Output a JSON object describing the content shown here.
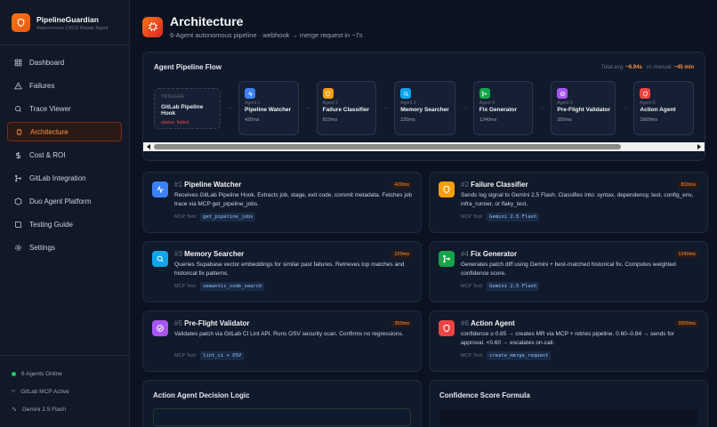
{
  "brand": {
    "title": "PipelineGuardian",
    "subtitle": "Autonomous CI/CD Repair Agent"
  },
  "nav": [
    {
      "label": "Dashboard",
      "icon": "grid-icon"
    },
    {
      "label": "Failures",
      "icon": "warning-icon"
    },
    {
      "label": "Trace Viewer",
      "icon": "search-icon"
    },
    {
      "label": "Architecture",
      "icon": "chip-icon",
      "active": true
    },
    {
      "label": "Cost & ROI",
      "icon": "dollar-icon"
    },
    {
      "label": "GitLab Integration",
      "icon": "branch-icon"
    },
    {
      "label": "Duo Agent Platform",
      "icon": "cube-icon"
    },
    {
      "label": "Testing Guide",
      "icon": "book-icon"
    },
    {
      "label": "Settings",
      "icon": "gear-icon"
    }
  ],
  "footer": [
    {
      "label": "6 Agents Online"
    },
    {
      "label": "GitLab MCP Active"
    },
    {
      "label": "Gemini 2.5 Flash"
    }
  ],
  "page": {
    "title": "Architecture",
    "subtitle": "6-Agent autonomous pipeline · webhook → merge request in ~7s"
  },
  "flow": {
    "title": "Agent Pipeline Flow",
    "total_label": "Total avg:",
    "total_value": "~6.94s",
    "manual_label": "vs manual:",
    "manual_value": "~45 min",
    "trigger": {
      "label": "TRIGGER",
      "name": "GitLab Pipeline Hook",
      "status": "status: failed"
    },
    "agents": [
      {
        "idx": "Agent 1",
        "name": "Pipeline Watcher",
        "ms": "420ms",
        "color": "#3b82f6"
      },
      {
        "idx": "Agent 2",
        "name": "Failure Classifier",
        "ms": "810ms",
        "color": "#f59e0b"
      },
      {
        "idx": "Agent 3",
        "name": "Memory Searcher",
        "ms": "220ms",
        "color": "#0ea5e9"
      },
      {
        "idx": "Agent 4",
        "name": "Fix Generator",
        "ms": "1240ms",
        "color": "#16a34a"
      },
      {
        "idx": "Agent 5",
        "name": "Pre-Flight Validator",
        "ms": "350ms",
        "color": "#a855f7"
      },
      {
        "idx": "Agent 6",
        "name": "Action Agent",
        "ms": "3900ms",
        "color": "#ef4444"
      }
    ]
  },
  "cards": [
    {
      "num": "#1",
      "name": "Pipeline Watcher",
      "ms": "420ms",
      "color": "#3b82f6",
      "desc": "Receives GitLab Pipeline Hook. Extracts job, stage, exit code, commit metadata. Fetches job trace via MCP get_pipeline_jobs.",
      "tool_label": "MCP Tool:",
      "tool": "get_pipeline_jobs"
    },
    {
      "num": "#2",
      "name": "Failure Classifier",
      "ms": "810ms",
      "color": "#f59e0b",
      "desc": "Sends log signal to Gemini 2.5 Flash. Classifies into: syntax, dependency, test, config_env, infra_runner, or flaky_test.",
      "tool_label": "MCP Tool:",
      "tool": "Gemini 2.5 Flash"
    },
    {
      "num": "#3",
      "name": "Memory Searcher",
      "ms": "220ms",
      "color": "#0ea5e9",
      "desc": "Queries Supabase vector embeddings for similar past failures. Retrieves top matches and historical fix patterns.",
      "tool_label": "MCP Tool:",
      "tool": "semantic_code_search"
    },
    {
      "num": "#4",
      "name": "Fix Generator",
      "ms": "1240ms",
      "color": "#16a34a",
      "desc": "Generates patch diff using Gemini + best-matched historical fix. Computes weighted confidence score.",
      "tool_label": "MCP Tool:",
      "tool": "Gemini 2.5 Flash"
    },
    {
      "num": "#5",
      "name": "Pre-Flight Validator",
      "ms": "350ms",
      "color": "#a855f7",
      "desc": "Validates patch via GitLab CI Lint API. Runs OSV security scan. Confirms no regressions.",
      "tool_label": "MCP Tool:",
      "tool": "lint_ci + OSV"
    },
    {
      "num": "#6",
      "name": "Action Agent",
      "ms": "3900ms",
      "color": "#ef4444",
      "desc": "confidence ≥ 0.85 → creates MR via MCP + retries pipeline. 0.60–0.84 → sends for approval. <0.60 → escalates on-call.",
      "tool_label": "MCP Tool:",
      "tool": "create_merge_request"
    }
  ],
  "bottom": {
    "decision_title": "Action Agent Decision Logic",
    "formula_title": "Confidence Score Formula"
  }
}
